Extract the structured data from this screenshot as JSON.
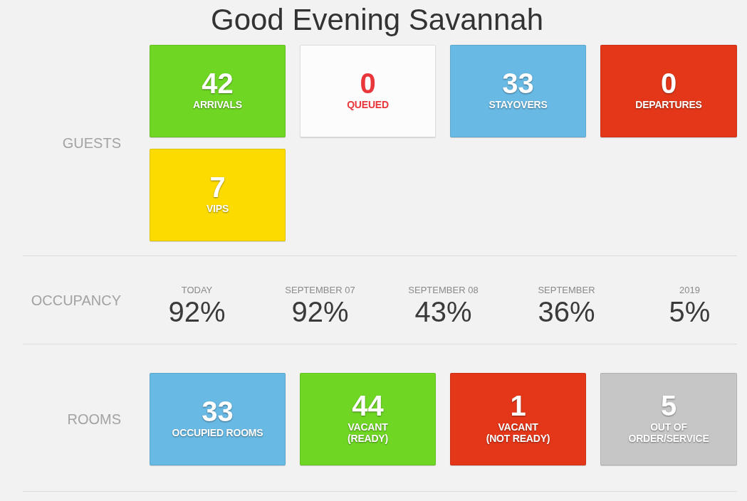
{
  "greeting": "Good Evening Savannah",
  "sections": [
    {
      "kind": "tiles",
      "label": "GUESTS",
      "tiles": [
        {
          "kind": "filled",
          "value": "42",
          "label": "ARRIVALS",
          "color": "#6fd724"
        },
        {
          "kind": "outline",
          "value": "0",
          "label": "QUEUED",
          "color": "#e8363a"
        },
        {
          "kind": "filled",
          "value": "33",
          "label": "STAYOVERS",
          "color": "#68b9e4"
        },
        {
          "kind": "filled",
          "value": "0",
          "label": "DEPARTURES",
          "color": "#e43719"
        },
        {
          "kind": "filled",
          "value": "7",
          "label": "VIPS",
          "color": "#fbdb00"
        }
      ]
    },
    {
      "kind": "stats",
      "label": "OCCUPANCY",
      "stats": [
        {
          "period": "TODAY",
          "value": "92%"
        },
        {
          "period": "SEPTEMBER 07",
          "value": "92%"
        },
        {
          "period": "SEPTEMBER 08",
          "value": "43%"
        },
        {
          "period": "SEPTEMBER",
          "value": "36%"
        },
        {
          "period": "2019",
          "value": "5%"
        }
      ]
    },
    {
      "kind": "tiles",
      "label": "ROOMS",
      "tiles": [
        {
          "kind": "filled",
          "value": "33",
          "label": "OCCUPIED ROOMS",
          "color": "#68b9e4"
        },
        {
          "kind": "filled",
          "value": "44",
          "label": "VACANT\n(READY)",
          "color": "#6fd724"
        },
        {
          "kind": "filled",
          "value": "1",
          "label": "VACANT\n(NOT READY)",
          "color": "#e43719"
        },
        {
          "kind": "filled",
          "value": "5",
          "label": "OUT OF\nORDER/SERVICE",
          "color": "#c6c6c6"
        }
      ]
    }
  ]
}
